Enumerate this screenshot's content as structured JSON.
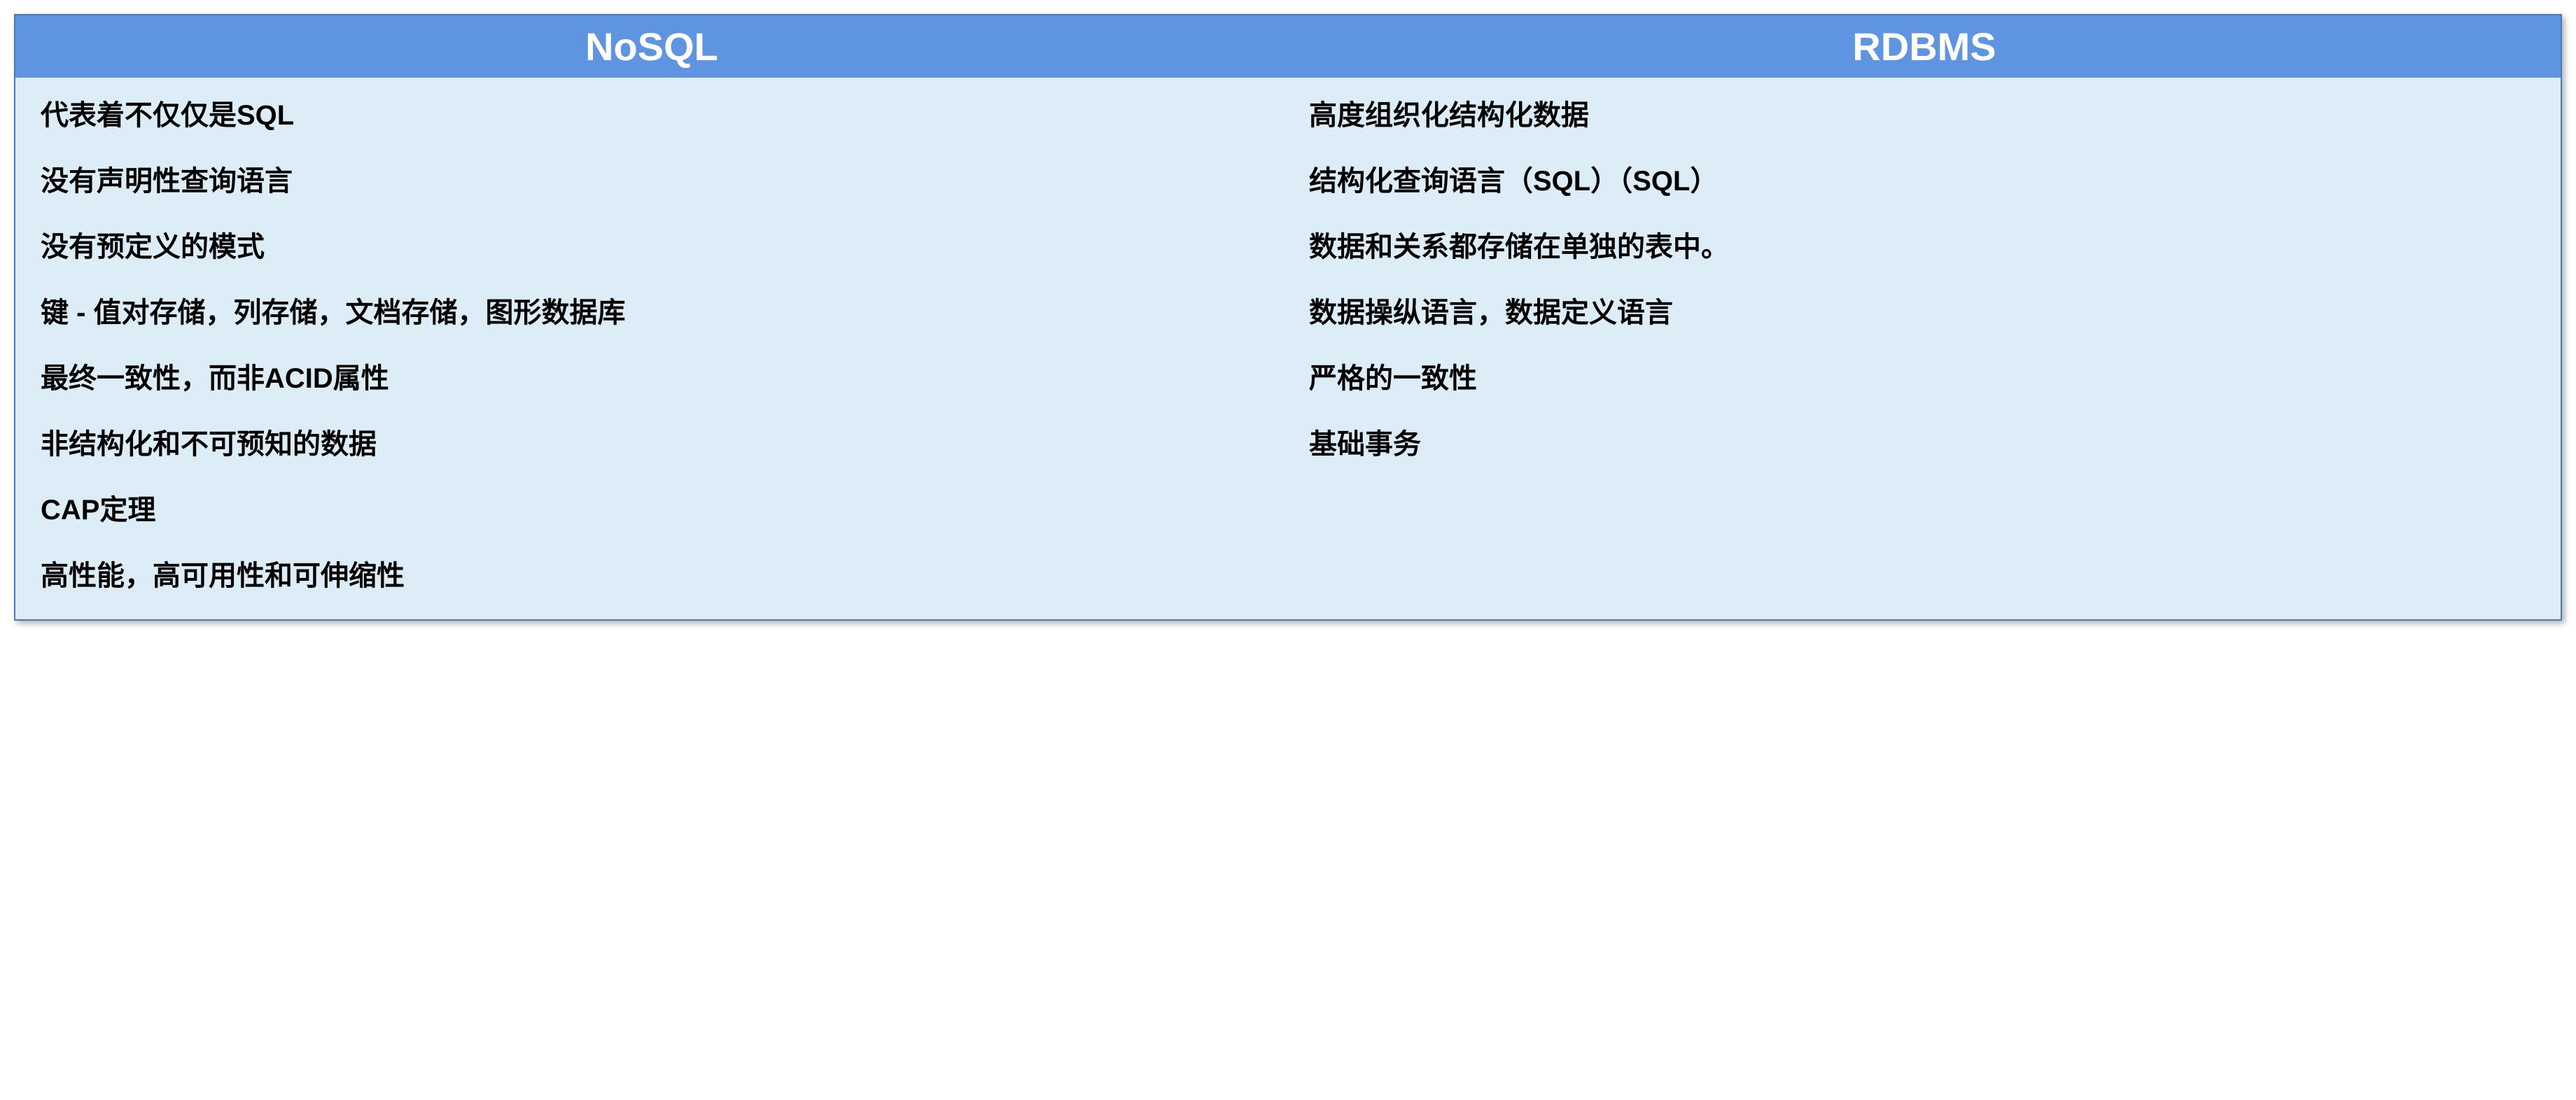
{
  "table": {
    "headers": {
      "left": "NoSQL",
      "right": "RDBMS"
    },
    "columns": {
      "nosql": [
        "代表着不仅仅是SQL",
        "没有声明性查询语言",
        "没有预定义的模式",
        "键 - 值对存储，列存储，文档存储，图形数据库",
        "最终一致性，而非ACID属性",
        "非结构化和不可预知的数据",
        "CAP定理",
        "高性能，高可用性和可伸缩性"
      ],
      "rdbms": [
        "高度组织化结构化数据",
        "结构化查询语言（SQL）（SQL）",
        "数据和关系都存储在单独的表中。",
        "数据操纵语言，数据定义语言",
        "严格的一致性",
        "基础事务"
      ]
    }
  }
}
